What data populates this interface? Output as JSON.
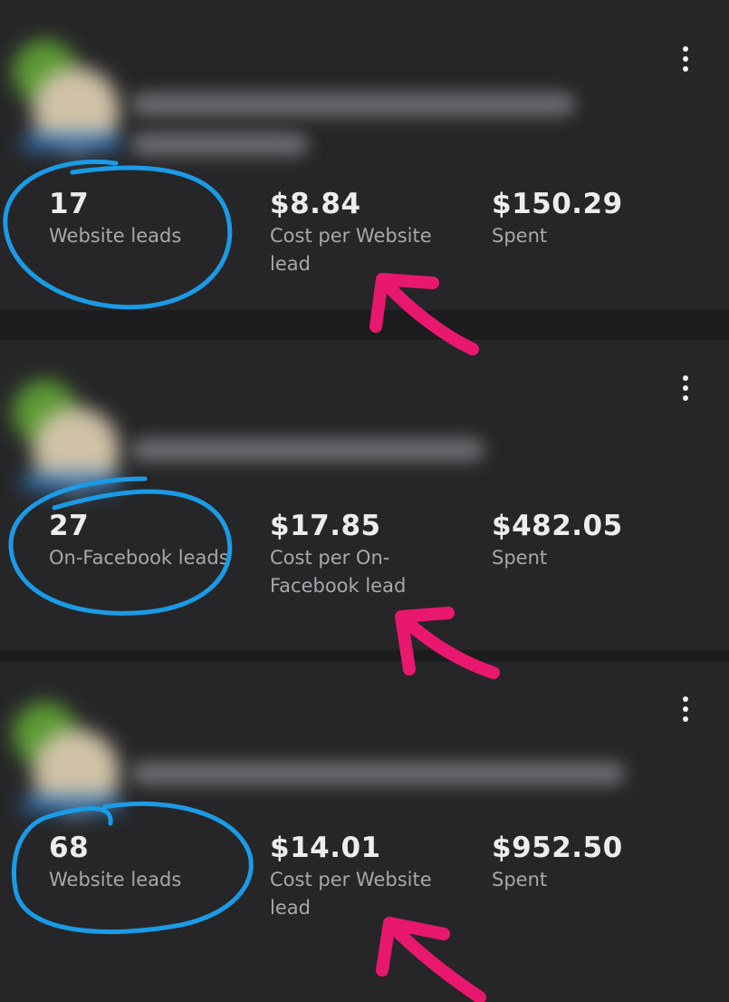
{
  "cards": [
    {
      "metrics": [
        {
          "value": "17",
          "label": "Website leads"
        },
        {
          "value": "$8.84",
          "label": "Cost per Website lead"
        },
        {
          "value": "$150.29",
          "label": "Spent"
        }
      ]
    },
    {
      "metrics": [
        {
          "value": "27",
          "label": "On-Facebook leads"
        },
        {
          "value": "$17.85",
          "label": "Cost per On-Facebook lead"
        },
        {
          "value": "$482.05",
          "label": "Spent"
        }
      ]
    },
    {
      "metrics": [
        {
          "value": "68",
          "label": "Website leads"
        },
        {
          "value": "$14.01",
          "label": "Cost per Website lead"
        },
        {
          "value": "$952.50",
          "label": "Spent"
        }
      ]
    }
  ],
  "colors": {
    "background": "#1c1c1e",
    "card": "#262628",
    "annotation_circle": "#1a9be6",
    "annotation_arrow": "#e8186e"
  },
  "icons": {
    "more_menu": "vertical-ellipsis-icon"
  }
}
